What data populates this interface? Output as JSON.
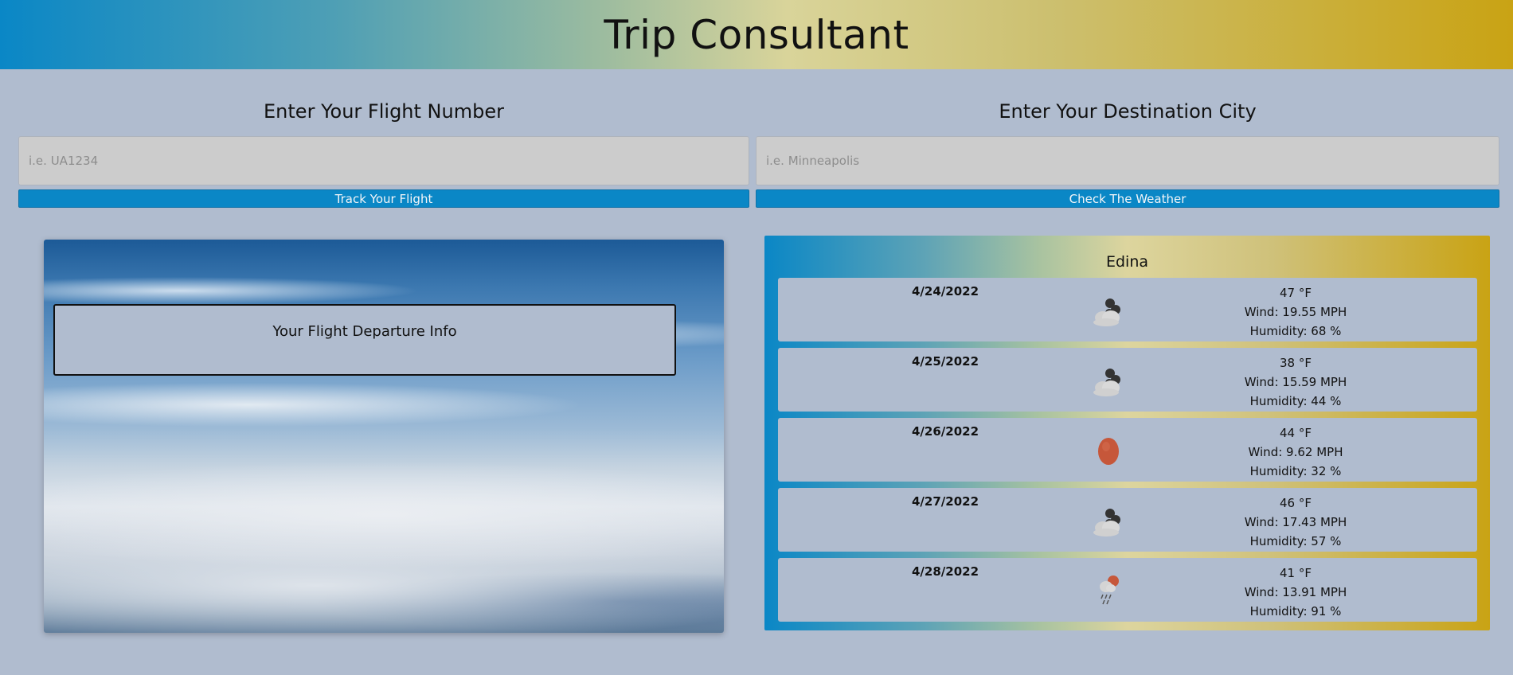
{
  "header": {
    "title": "Trip Consultant"
  },
  "flight": {
    "heading": "Enter Your Flight Number",
    "placeholder": "i.e. UA1234",
    "value": "",
    "button_label": "Track Your Flight",
    "departure_info": "Your Flight Departure Info"
  },
  "weather": {
    "heading": "Enter Your Destination City",
    "placeholder": "i.e. Minneapolis",
    "value": "",
    "button_label": "Check The Weather",
    "city": "Edina",
    "forecast": [
      {
        "date": "4/24/2022",
        "icon": "cloud-rain-icon",
        "temp": "47 °F",
        "wind": "Wind: 19.55 MPH",
        "humidity": "Humidity: 68 %"
      },
      {
        "date": "4/25/2022",
        "icon": "cloud-rain-icon",
        "temp": "38 °F",
        "wind": "Wind: 15.59 MPH",
        "humidity": "Humidity: 44 %"
      },
      {
        "date": "4/26/2022",
        "icon": "sun-icon",
        "temp": "44 °F",
        "wind": "Wind: 9.62 MPH",
        "humidity": "Humidity: 32 %"
      },
      {
        "date": "4/27/2022",
        "icon": "cloud-rain-icon",
        "temp": "46 °F",
        "wind": "Wind: 17.43 MPH",
        "humidity": "Humidity: 57 %"
      },
      {
        "date": "4/28/2022",
        "icon": "sun-rain-icon",
        "temp": "41 °F",
        "wind": "Wind: 13.91 MPH",
        "humidity": "Humidity: 91 %"
      }
    ]
  },
  "colors": {
    "background": "#b0bccf",
    "accent_blue": "#0a87c6",
    "accent_gold": "#c9a314",
    "sun": "#c6573a"
  }
}
